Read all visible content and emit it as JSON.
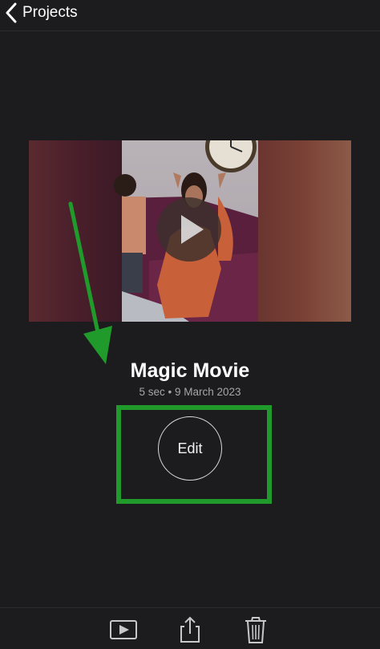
{
  "nav": {
    "back_label": "Projects"
  },
  "project": {
    "title": "Magic Movie",
    "subtitle": "5 sec • 9 March 2023"
  },
  "actions": {
    "edit_label": "Edit"
  },
  "toolbar": {
    "icons": [
      "play-icon",
      "share-icon",
      "trash-icon"
    ]
  },
  "colors": {
    "background": "#1c1c1e",
    "annotation_green": "#1f9a2b",
    "icon_gray": "#c7c7cc"
  }
}
